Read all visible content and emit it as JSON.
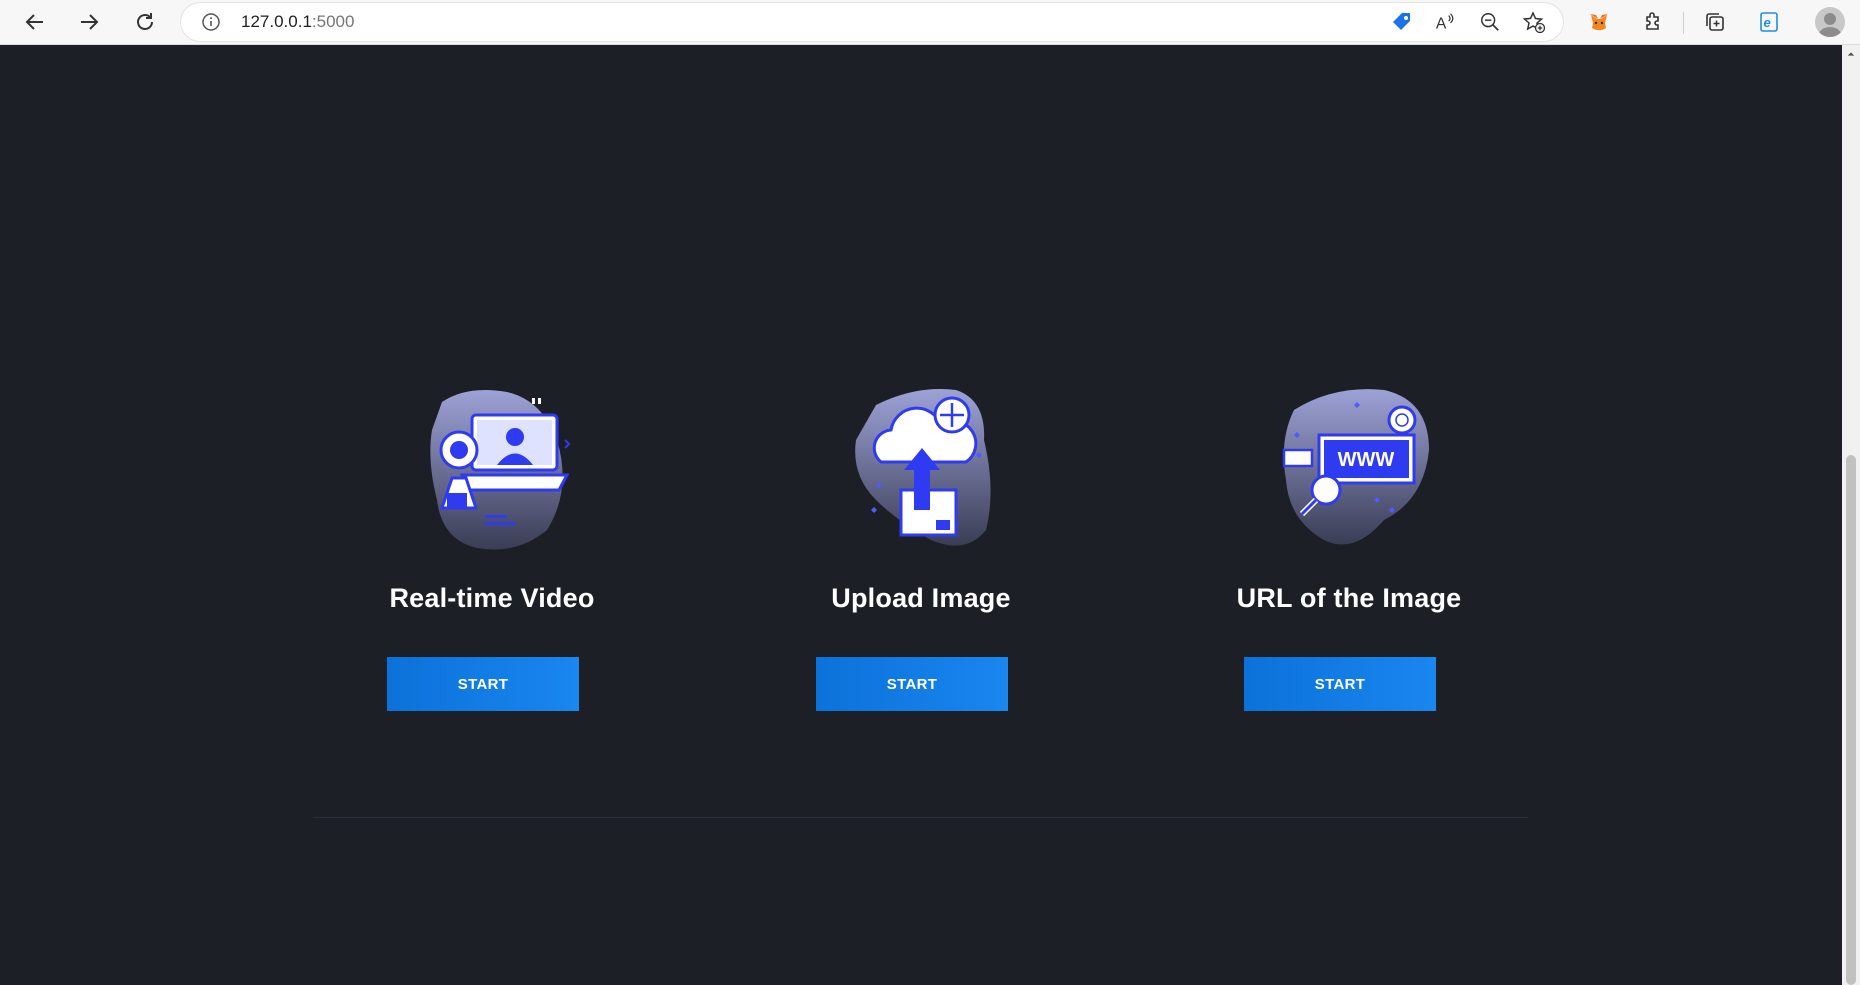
{
  "browser": {
    "url_host": "127.0.0.1",
    "url_port": ":5000",
    "icons": [
      "back-icon",
      "forward-icon",
      "refresh-icon",
      "info-icon",
      "tag-icon",
      "read-aloud-icon",
      "zoom-out-icon",
      "add-favorite-icon",
      "metamask-icon",
      "extensions-icon",
      "collections-icon",
      "edge-icon",
      "profile-avatar"
    ]
  },
  "cards": [
    {
      "title": "Real-time Video",
      "button": "START",
      "icon": "video-illustration-icon"
    },
    {
      "title": "Upload Image",
      "button": "START",
      "icon": "upload-illustration-icon"
    },
    {
      "title": "URL of the Image",
      "button": "START",
      "icon": "url-illustration-icon"
    }
  ],
  "colors": {
    "background": "#1d1f27",
    "button": "#1582ec",
    "illustration_blue": "#2f3bf0",
    "blob": "#8a8fb8"
  }
}
